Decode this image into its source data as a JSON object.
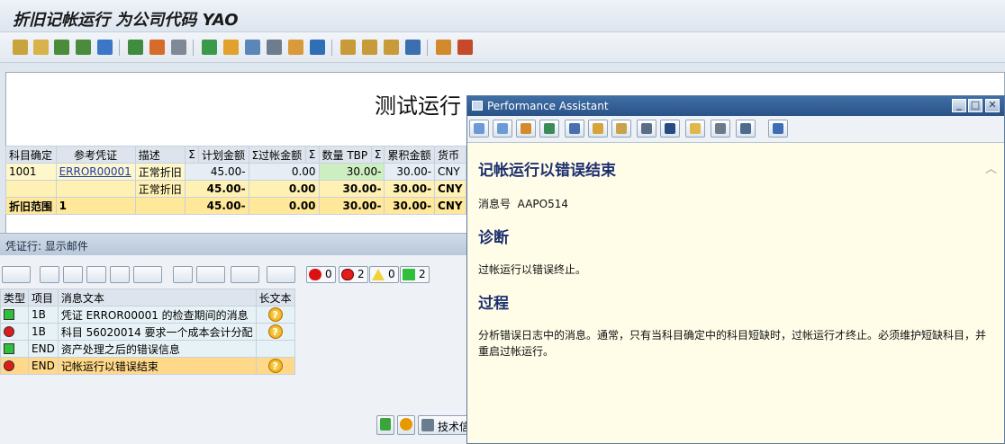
{
  "window": {
    "title": "折旧记帐运行 为公司代码 YAO"
  },
  "main": {
    "heading": "测试运行"
  },
  "grid": {
    "headers": [
      "科目确定",
      "参考凭证",
      "描述",
      "Σ",
      "计划金额",
      "Σ过帐金额",
      "Σ",
      "数量 TBP",
      "Σ",
      "累积金额",
      "货币"
    ],
    "rows": [
      {
        "account": "1001",
        "ref": "ERROR00001",
        "desc": "正常折旧",
        "planned": "45.00-",
        "posted": "0.00",
        "qty": "30.00-",
        "accum": "30.00-",
        "curr": "CNY"
      },
      {
        "account": "",
        "ref": "",
        "desc": "正常折旧",
        "planned": "45.00-",
        "posted": "0.00",
        "qty": "30.00-",
        "accum": "30.00-",
        "curr": "CNY"
      },
      {
        "account": "折旧范围",
        "ref": "1",
        "desc": "",
        "planned": "45.00-",
        "posted": "0.00",
        "qty": "30.00-",
        "accum": "30.00-",
        "curr": "CNY"
      }
    ]
  },
  "messages": {
    "title": "凭证行: 显示邮件",
    "counts": {
      "stop": "0",
      "error": "2",
      "warning": "0",
      "success": "2"
    },
    "headers": {
      "type": "类型",
      "item": "项目",
      "text": "消息文本",
      "longtext": "长文本"
    },
    "rows": [
      {
        "status": "green",
        "item": "1B",
        "text": "凭证 ERROR00001 的检查期间的消息",
        "help": "?"
      },
      {
        "status": "red",
        "item": "1B",
        "text": "科目 56020014 要求一个成本会计分配",
        "help": "?"
      },
      {
        "status": "green",
        "item": "END",
        "text": "资产处理之后的错误信息",
        "help": ""
      },
      {
        "status": "red",
        "item": "END",
        "text": "记帐运行以错误结束",
        "help": "?"
      }
    ]
  },
  "bottom": {
    "techinfo_label": "技术信"
  },
  "assistant": {
    "title": "Performance Assistant",
    "heading": "记帐运行以错误结束",
    "msgno_label": "消息号",
    "msgno": "AAPO514",
    "diag_title": "诊断",
    "diag_text": "过帐运行以错误终止。",
    "proc_title": "过程",
    "proc_text": "分析错误日志中的消息。通常，只有当科目确定中的科目短缺时，过帐运行才终止。必须维护短缺科目，并重启过帐运行。"
  },
  "colors": {
    "accent": "#2a5287",
    "selected_row": "#ffd88a",
    "help_bg": "#fffde8"
  }
}
